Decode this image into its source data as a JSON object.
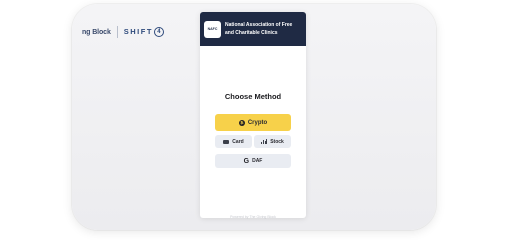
{
  "sponsor": {
    "brand1": "ng Block",
    "brand2": "SHIFT",
    "brand2_mark": "4"
  },
  "organization": {
    "name_line1": "National Association of Free",
    "name_line2": "and Charitable Clinics",
    "logo_text": "NAFC"
  },
  "widget": {
    "title": "Choose Method",
    "methods": {
      "crypto": "Crypto",
      "card": "Card",
      "stock": "Stock",
      "daf": "DAF"
    },
    "footer": "Powered by  The Giving Block"
  }
}
